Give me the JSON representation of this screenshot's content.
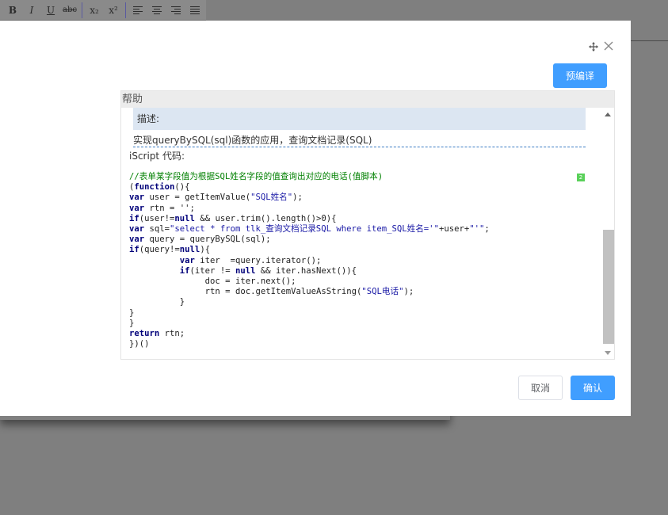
{
  "toolbar": {
    "bold_label": "B",
    "italic_label": "I",
    "underline_label": "U",
    "strike_label": "abc",
    "subscript_label": "x₂",
    "superscript_label": "x²"
  },
  "dialog": {
    "precompile_label": "预编译",
    "cancel_label": "取消",
    "confirm_label": "确认"
  },
  "help": {
    "header": "帮助",
    "description_label": "描述:",
    "description_text": "实现queryBySQL(sql)函数的应用，查询文档记录(SQL)",
    "code_label": "iScript 代码:",
    "badge": "2"
  },
  "code": {
    "comment": "//表单某字段值为根据SQL姓名字段的值查询出对应的电话(值脚本)",
    "line1": "(function(){",
    "line2": "var user = getItemValue(\"SQL姓名\");",
    "line3": "var rtn = '';",
    "line4": "if(user!=null && user.trim().length()>0){",
    "line5": "var sql=\"select * from tlk_查询文档记录SQL where item_SQL姓名='\"+user+\"'\";",
    "line6": "var query = queryBySQL(sql);",
    "line7": "if(query!=null){",
    "line8": "var iter  =query.iterator();",
    "line9": "if(iter != null && iter.hasNext()){",
    "line10": "doc = iter.next();",
    "line11": "rtn = doc.getItemValueAsString(\"SQL电话\");",
    "line12": "}",
    "line13": "}",
    "line14": "}",
    "line15": "return rtn;",
    "line16": "})()"
  },
  "icons": {
    "move": "move-icon",
    "close": "close-icon"
  },
  "colors": {
    "primary": "#409eff",
    "description_bg": "#dce6f2",
    "keyword": "#00007a",
    "comment": "#008000",
    "string": "#1a1aa6"
  }
}
